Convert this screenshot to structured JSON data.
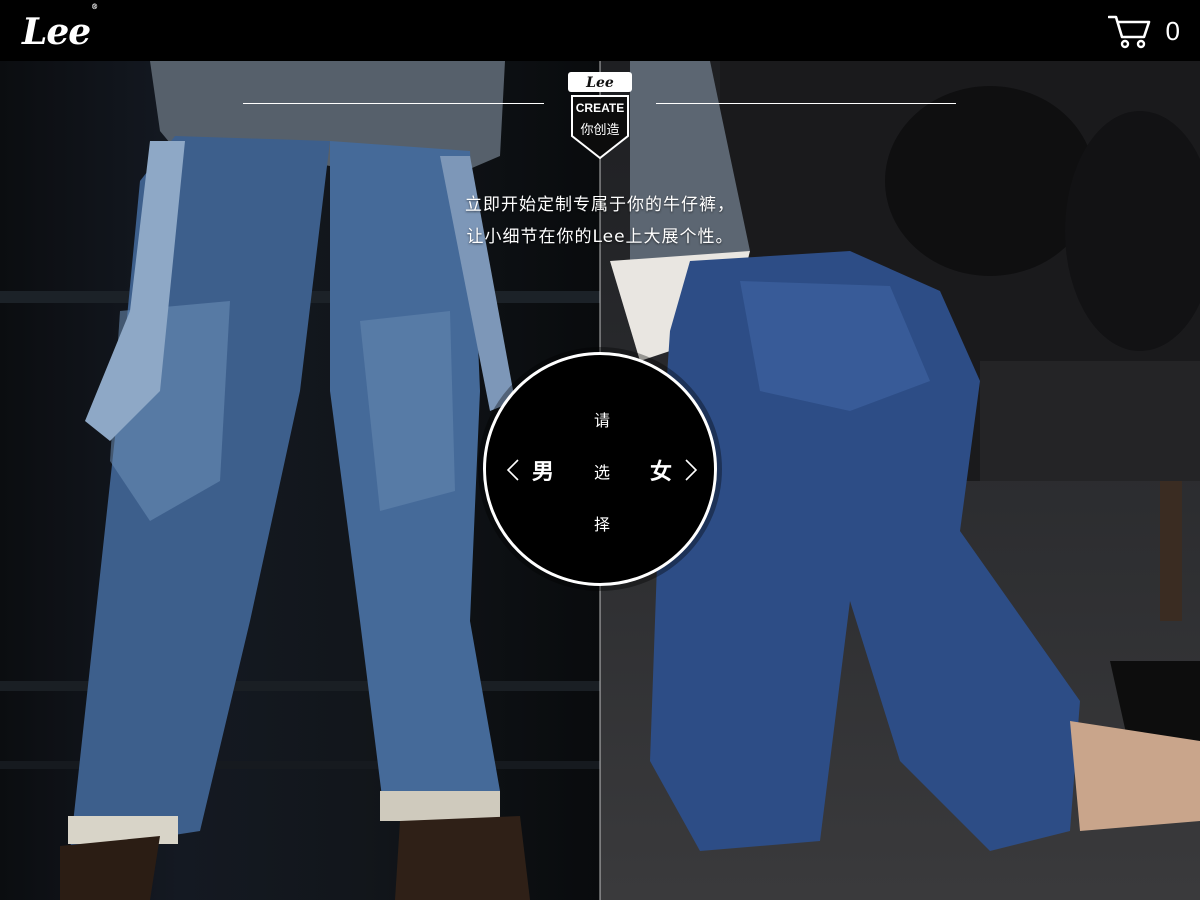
{
  "brand": {
    "logo_text": "Lee",
    "registered_mark": "®"
  },
  "cart": {
    "icon": "cart-icon",
    "count": "0"
  },
  "badge": {
    "brand": "Lee",
    "word": "CREATE",
    "subtitle": "你创造"
  },
  "tagline": {
    "line1": "立即开始定制专属于你的牛仔裤，",
    "line2": "让小细节在你的Lee上大展个性。"
  },
  "selector": {
    "prompt_chars": [
      "请",
      "选",
      "择"
    ],
    "men_label": "男",
    "women_label": "女",
    "men_icon": "chevron-left-icon",
    "women_icon": "chevron-right-icon"
  },
  "panels": {
    "men_image": "mens-jeans-photo",
    "women_image": "womens-jeans-photo"
  }
}
